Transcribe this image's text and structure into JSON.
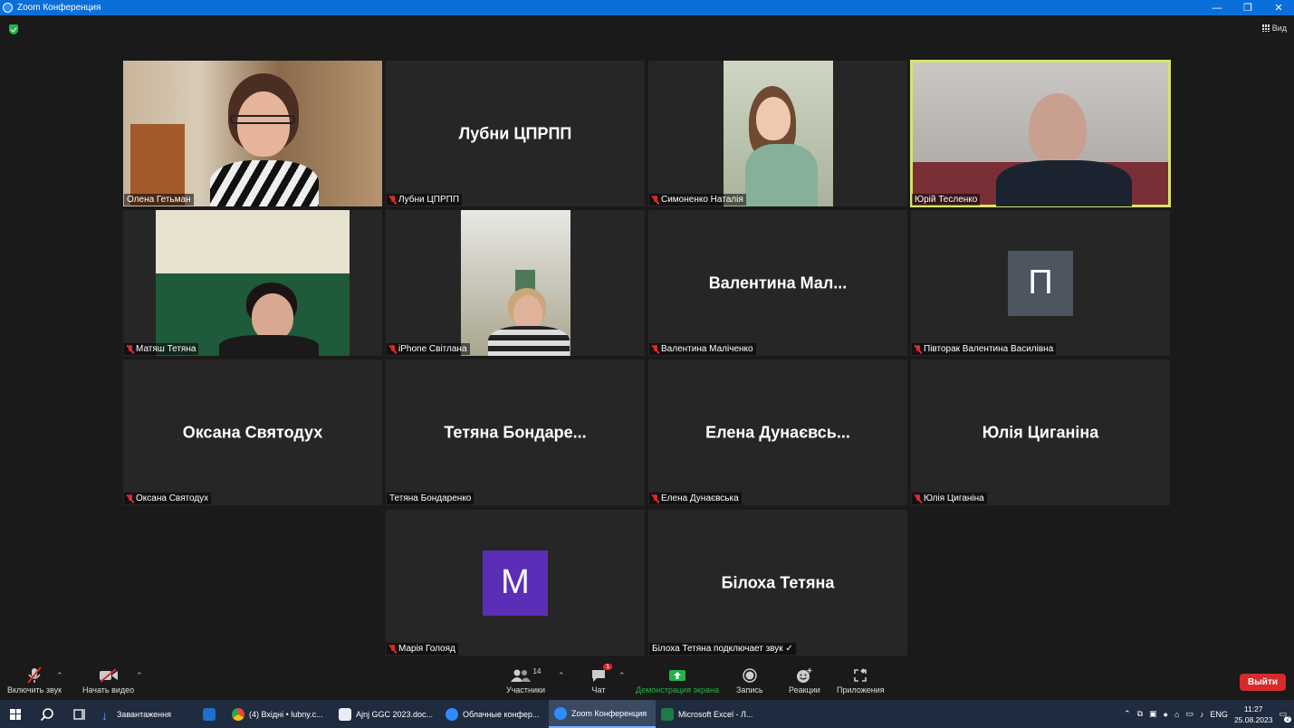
{
  "window": {
    "title": "Zoom Конференция",
    "min": "—",
    "max": "❐",
    "close": "✕"
  },
  "top": {
    "view_label": "Вид"
  },
  "participants_tiles": [
    {
      "name": "Олена Гетьман",
      "display": "",
      "muted": false
    },
    {
      "name": "Лубни ЦПРПП",
      "display": "Лубни ЦПРПП",
      "muted": true
    },
    {
      "name": "Симоненко Наталія",
      "display": "",
      "muted": true
    },
    {
      "name": "Юрій Тесленко",
      "display": "",
      "muted": false
    },
    {
      "name": "Матяш Тетяна",
      "display": "",
      "muted": true
    },
    {
      "name": "iPhone Світлана",
      "display": "",
      "muted": true
    },
    {
      "name": "Валентина Маліченко",
      "display": "Валентина  Мал...",
      "muted": true
    },
    {
      "name": "Півторак Валентина Василівна",
      "display": "П",
      "muted": true,
      "avatar_color": "#4c5560"
    },
    {
      "name": "Оксана Святодух",
      "display": "Оксана Святодух",
      "muted": true
    },
    {
      "name": "Тетяна Бондаренко",
      "display": "Тетяна  Бондаре...",
      "muted": false
    },
    {
      "name": "Елена Дунаєвська",
      "display": "Елена  Дунаєвсь...",
      "muted": true
    },
    {
      "name": "Юлія Циганіна",
      "display": "Юлія Циганіна",
      "muted": true
    },
    {
      "name": "Марія Голояд",
      "display": "М",
      "muted": true,
      "avatar_color": "#5b2eb8"
    },
    {
      "name": "Білоха Тетяна подключает звук ✓",
      "display": "Білоха Тетяна",
      "muted": false
    }
  ],
  "toolbar": {
    "unmute": "Включить звук",
    "start_video": "Начать видео",
    "participants": "Участники",
    "participants_count": "14",
    "chat": "Чат",
    "chat_badge": "1",
    "share": "Демонстрация экрана",
    "record": "Запись",
    "reactions": "Реакции",
    "apps": "Приложения",
    "leave": "Выйти"
  },
  "taskbar": {
    "apps": [
      {
        "label": "Завантаження",
        "color": "#2f7de1"
      },
      {
        "label": "",
        "color": "#1e6fd0"
      },
      {
        "label": "(4) Вхідні • lubny.c...",
        "color": "#e8463a"
      },
      {
        "label": "Ajnj GGC 2023.doc...",
        "color": "#e9eef5"
      },
      {
        "label": "Облачные конфер...",
        "color": "#2d8cff"
      },
      {
        "label": "Zoom Конференция",
        "color": "#2d8cff"
      },
      {
        "label": "Microsoft Excel - Л...",
        "color": "#1f7a45"
      }
    ],
    "lang": "ENG",
    "time": "11:27",
    "date": "25.08.2023",
    "notif_count": "2"
  },
  "colors": {
    "accent": "#2d8cff",
    "active_speaker": "#d7e36b",
    "leave": "#d62b2b",
    "share": "#23b24b"
  }
}
